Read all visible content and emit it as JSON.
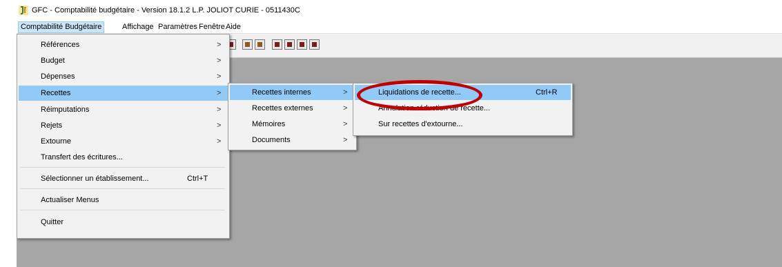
{
  "window": {
    "title": "GFC - Comptabilité budgétaire - Version 18.1.2   L.P. JOLIOT CURIE - 0511430C"
  },
  "menubar": {
    "items": [
      "Comptabilité Budgétaire",
      "Affichage",
      "Paramètres",
      "Fenêtre",
      "Aide"
    ],
    "active": "Comptabilité Budgétaire"
  },
  "main_menu": {
    "items": [
      {
        "label": "Références",
        "submenu": true
      },
      {
        "label": "Budget",
        "submenu": true
      },
      {
        "label": "Dépenses",
        "submenu": true
      },
      {
        "label": "Recettes",
        "submenu": true,
        "highlighted": true
      },
      {
        "label": "Réimputations",
        "submenu": true
      },
      {
        "label": "Rejets",
        "submenu": true
      },
      {
        "label": "Extourne",
        "submenu": true
      },
      {
        "label": "Transfert des écritures...",
        "submenu": false
      },
      {
        "label": "Sélectionner un établissement...",
        "shortcut": "Ctrl+T"
      },
      {
        "label": "Actualiser Menus"
      },
      {
        "label": "Quitter"
      }
    ]
  },
  "recettes_menu": {
    "items": [
      {
        "label": "Recettes internes",
        "submenu": true,
        "highlighted": true
      },
      {
        "label": "Recettes externes",
        "submenu": true
      },
      {
        "label": "Mémoires",
        "submenu": true
      },
      {
        "label": "Documents",
        "submenu": true
      }
    ]
  },
  "internes_menu": {
    "items": [
      {
        "label": "Liquidations de recette...",
        "shortcut": "Ctrl+R",
        "highlighted": true
      },
      {
        "label": "Annulation-réduction de recette..."
      },
      {
        "label": "Sur recettes d'extourne..."
      }
    ]
  },
  "arrow_glyph": ">",
  "colors": {
    "highlight": "#91c9f7",
    "annotation": "#c00000",
    "workspace": "#a6a6a6"
  }
}
